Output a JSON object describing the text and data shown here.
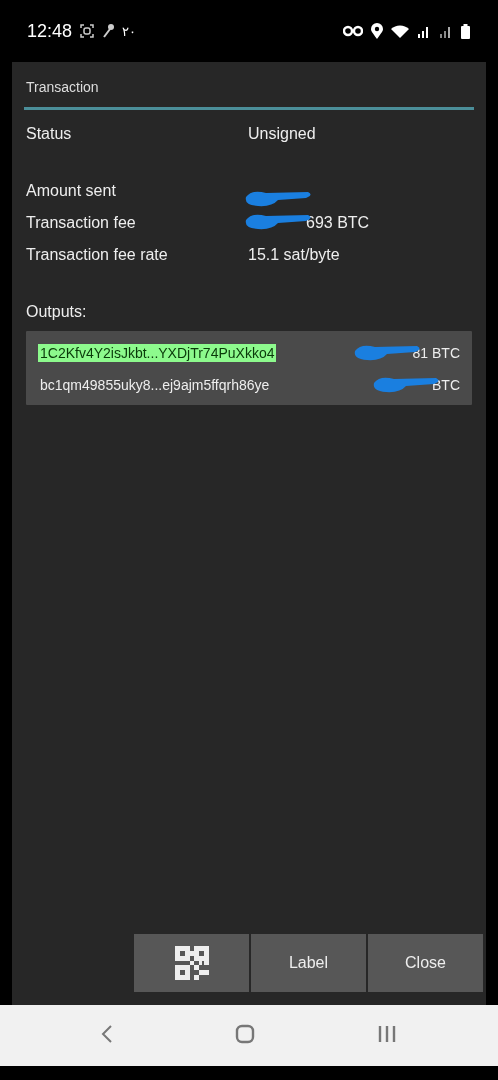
{
  "status_bar": {
    "time": "12:48",
    "indicator": "٢٠"
  },
  "dialog": {
    "title": "Transaction",
    "field_groups": [
      [
        {
          "label": "Status",
          "value": "Unsigned"
        }
      ],
      [
        {
          "label": "Amount sent",
          "redacted": true
        },
        {
          "label": "Transaction fee",
          "value": "693 BTC",
          "redacted": true
        },
        {
          "label": "Transaction fee rate",
          "value": "15.1 sat/byte"
        }
      ]
    ],
    "outputs_label": "Outputs:",
    "outputs": [
      {
        "address": "1C2Kfv4Y2isJkbt...YXDjTr74PuXkko4",
        "amount": "81 BTC",
        "redacted": true,
        "highlighted": true
      },
      {
        "address": "bc1qm49855uky8...ej9ajm5ffqrh86ye",
        "amount": "BTC",
        "redacted": true,
        "highlighted": false
      }
    ],
    "buttons": [
      {
        "kind": "qr"
      },
      {
        "kind": "text",
        "label": "Label"
      },
      {
        "kind": "text",
        "label": "Close"
      }
    ]
  }
}
